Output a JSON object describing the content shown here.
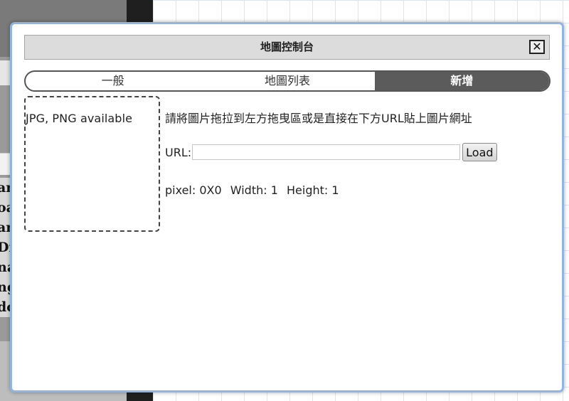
{
  "dialog": {
    "title": "地圖控制台",
    "close_label": "✕"
  },
  "tabs": [
    {
      "label": "一般",
      "active": false
    },
    {
      "label": "地圖列表",
      "active": false
    },
    {
      "label": "新增",
      "active": true
    }
  ],
  "dropzone": {
    "hint": "JPG, PNG available"
  },
  "add_panel": {
    "instructions": "請將圖片拖拉到左方拖曳區或是直接在下方URL貼上圖片網址",
    "url_label": "URL:",
    "url_value": "",
    "load_label": "Load",
    "pixel_text": "pixel: 0X0",
    "width_text": "Width: 1",
    "height_text": "Height: 1"
  },
  "colors": {
    "dialog_border": "#8fb4e6",
    "active_tab": "#5b5b5b",
    "titlebar": "#dcdcdc"
  }
}
